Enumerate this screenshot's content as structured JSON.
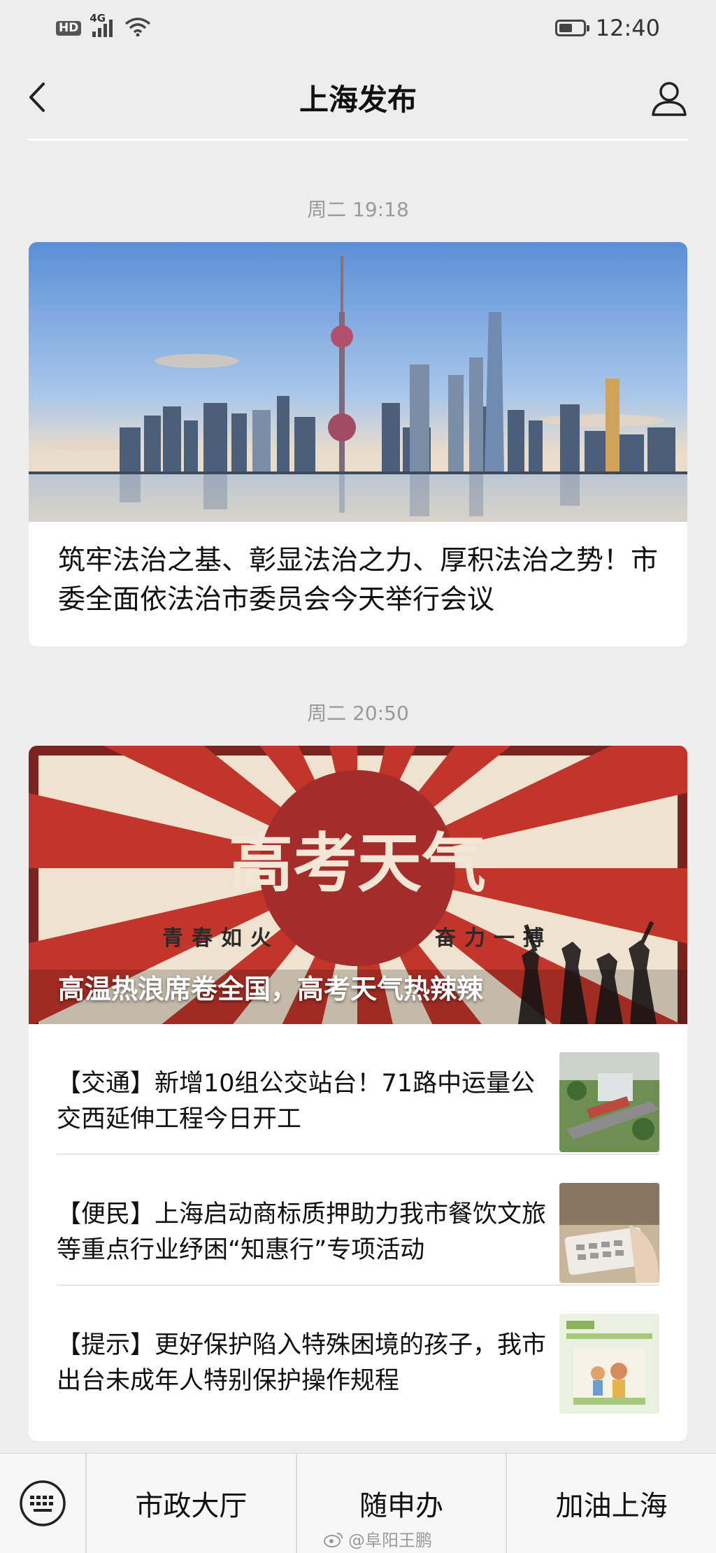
{
  "status_bar": {
    "hd": "HD",
    "network": "4G",
    "time": "12:40",
    "battery_level": 0.55
  },
  "nav": {
    "title": "上海发布",
    "back_icon": "chevron-left-icon",
    "profile_icon": "user-profile-icon"
  },
  "messages": [
    {
      "time": "周二 19:18",
      "title": "筑牢法治之基、彰显法治之力、厚积法治之势！市委全面依法治市委员会今天举行会议"
    },
    {
      "time": "周二 20:50",
      "banner": {
        "headline": "高考天气",
        "slogan_left": "青春如火",
        "slogan_right": "奋力一搏",
        "caption": "高温热浪席卷全国，高考天气热辣辣"
      },
      "items": [
        {
          "title": "【交通】新增10组公交站台！71路中运量公交西延伸工程今日开工"
        },
        {
          "title": "【便民】上海启动商标质押助力我市餐饮文旅等重点行业纾困“知惠行”专项活动"
        },
        {
          "title": "【提示】更好保护陷入特殊困境的孩子，我市出台未成年人特别保护操作规程"
        }
      ]
    }
  ],
  "bottom_menu": {
    "keyboard_icon": "keyboard-icon",
    "items": [
      "市政大厅",
      "随申办",
      "加油上海"
    ]
  },
  "watermark": "@阜阳王鹏",
  "colors": {
    "background": "#ededed",
    "banner_red": "#c2352b",
    "banner_cream": "#efe3cf"
  }
}
